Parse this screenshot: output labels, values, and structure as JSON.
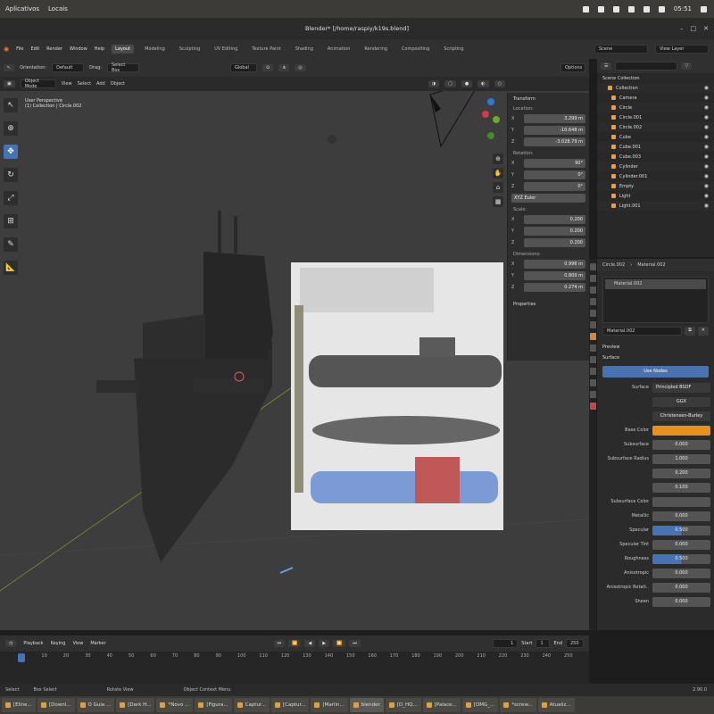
{
  "system_bar": {
    "menu": [
      "Aplicativos",
      "Locais"
    ],
    "time": "05:51"
  },
  "window": {
    "title": "Blender* [/home/raspiy/k19s.blend]"
  },
  "menubar": {
    "items": [
      "File",
      "Edit",
      "Render",
      "Window",
      "Help"
    ],
    "workspaces": [
      "Layout",
      "Modeling",
      "Sculpting",
      "UV Editing",
      "Texture Paint",
      "Shading",
      "Animation",
      "Rendering",
      "Compositing",
      "Scripting"
    ],
    "scene_label": "Scene",
    "view_layer_label": "View Layer"
  },
  "header": {
    "orientation": "Orientation:",
    "orientation_value": "Default",
    "drag": "Drag:",
    "drag_value": "Select Box",
    "transform": "Global",
    "options": "Options"
  },
  "header2": {
    "mode": "Object Mode",
    "items": [
      "View",
      "Select",
      "Add",
      "Object"
    ]
  },
  "viewport": {
    "line1": "User Perspective",
    "line2": "(1) Collection | Circle.002"
  },
  "npanel": {
    "transform_title": "Transform",
    "location_label": "Location:",
    "location": [
      {
        "ax": "X",
        "val": "3.299 m"
      },
      {
        "ax": "Y",
        "val": "-10.648 m"
      },
      {
        "ax": "Z",
        "val": "-3.028.79 m"
      }
    ],
    "rotation_label": "Rotation:",
    "rotation": [
      {
        "ax": "X",
        "val": "90°"
      },
      {
        "ax": "Y",
        "val": "0°"
      },
      {
        "ax": "Z",
        "val": "0°"
      }
    ],
    "rotation_mode": "XYZ Euler",
    "scale_label": "Scale:",
    "scale": [
      {
        "ax": "X",
        "val": "0.200"
      },
      {
        "ax": "Y",
        "val": "0.200"
      },
      {
        "ax": "Z",
        "val": "0.200"
      }
    ],
    "dimensions_label": "Dimensions:",
    "dimensions": [
      {
        "ax": "X",
        "val": "0.996 m"
      },
      {
        "ax": "Y",
        "val": "0.800 m"
      },
      {
        "ax": "Z",
        "val": "0.274 m"
      }
    ],
    "properties_title": "Properties"
  },
  "outliner": {
    "title": "Scene Collection",
    "items": [
      "Collection",
      "Camera",
      "Circle",
      "Circle.001",
      "Circle.002",
      "Cube",
      "Cube.001",
      "Cube.003",
      "Cylinder",
      "Cylinder.001",
      "Empty",
      "Light",
      "Light.001"
    ]
  },
  "properties": {
    "object_name": "Circle.002",
    "material_name": "Material.002",
    "slot_name": "Material.002",
    "preview_label": "Preview",
    "surface_section": "Surface",
    "use_nodes": "Use Nodes",
    "surface_label": "Surface",
    "surface_value": "Principled BSDF",
    "ggx": "GGX",
    "multiscatter": "Christensen-Burley",
    "base_color_label": "Base Color",
    "base_color": "#e8901a",
    "rows": [
      {
        "label": "Subsurface",
        "value": "0.000"
      },
      {
        "label": "Subsurface Radius",
        "value": "1.000"
      },
      {
        "label": "",
        "value": "0.200"
      },
      {
        "label": "",
        "value": "0.100"
      },
      {
        "label": "Subsurface Color",
        "value": ""
      },
      {
        "label": "Metallic",
        "value": "0.000"
      },
      {
        "label": "Specular",
        "value": "0.500"
      },
      {
        "label": "Specular Tint",
        "value": "0.000"
      },
      {
        "label": "Roughness",
        "value": "0.500"
      },
      {
        "label": "Anisotropic",
        "value": "0.000"
      },
      {
        "label": "Anisotropic Rotati..",
        "value": "0.000"
      },
      {
        "label": "Sheen",
        "value": "0.000"
      }
    ]
  },
  "timeline": {
    "items": [
      "Playback",
      "Keying",
      "View",
      "Marker"
    ],
    "current_frame": "1",
    "start_label": "Start",
    "start": "1",
    "end_label": "End",
    "end": "250",
    "ticks": [
      "0",
      "10",
      "20",
      "30",
      "40",
      "50",
      "60",
      "70",
      "80",
      "90",
      "100",
      "110",
      "120",
      "130",
      "140",
      "150",
      "160",
      "170",
      "180",
      "190",
      "200",
      "210",
      "220",
      "230",
      "240",
      "250"
    ]
  },
  "statusbar": {
    "items": [
      "Select",
      "Box Select",
      "Rotate View",
      "Object Context Menu"
    ],
    "version": "2.90.0"
  },
  "taskbar": {
    "items": [
      "[Eline...",
      "[Downl...",
      "O Guia ...",
      "[Dark H...",
      "*Novo ...",
      "[Figura...",
      "Captur...",
      "[Captur...",
      "[Marlin...",
      "blender",
      "[D_HQ...",
      "[Palace...",
      "[OMG_...",
      "*screw...",
      "Atualiz..."
    ]
  }
}
